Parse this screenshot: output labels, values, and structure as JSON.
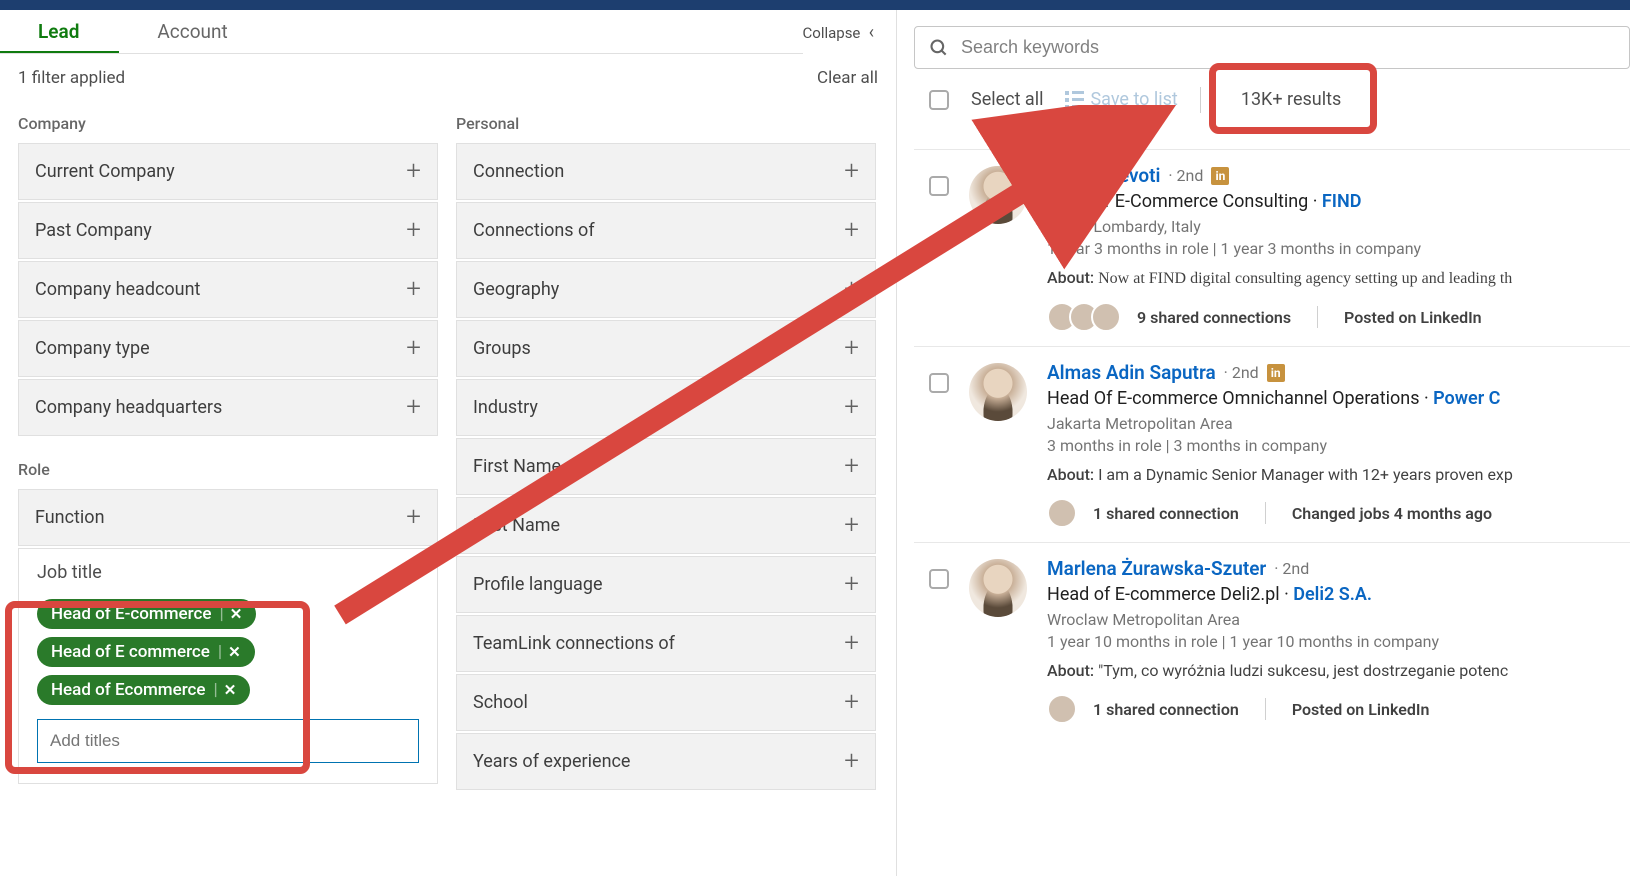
{
  "tabs": {
    "lead": "Lead",
    "account": "Account"
  },
  "header": {
    "filters_applied": "1 filter applied",
    "collapse": "Collapse",
    "clear_all": "Clear all"
  },
  "sections": {
    "company": "Company",
    "role": "Role",
    "personal": "Personal"
  },
  "filters": {
    "current_company": "Current Company",
    "past_company": "Past Company",
    "company_headcount": "Company headcount",
    "company_type": "Company type",
    "company_headquarters": "Company headquarters",
    "function_f": "Function",
    "job_title": "Job title",
    "connection": "Connection",
    "connections_of": "Connections of",
    "geography": "Geography",
    "groups": "Groups",
    "industry": "Industry",
    "first_name": "First Name",
    "last_name": "Last Name",
    "profile_language": "Profile language",
    "teamlink": "TeamLink connections of",
    "school": "School",
    "years_exp": "Years of experience"
  },
  "job_title_chips": [
    "Head of E-commerce",
    "Head of E commerce",
    "Head of Ecommerce"
  ],
  "job_title_placeholder": "Add titles",
  "search": {
    "placeholder": "Search keywords"
  },
  "results_bar": {
    "select_all": "Select all",
    "save_to_list": "Save to list",
    "count": "13K+ results"
  },
  "results": [
    {
      "name": "Mattia Devoti",
      "degree": "2nd",
      "badge": "in",
      "title": "Head of E-Commerce Consulting",
      "company": "FIND",
      "location": "Milan, Lombardy, Italy",
      "tenure": "1 year 3 months in role | 1 year 3 months in company",
      "about_label": "About:",
      "about": "Now at FIND digital consulting agency setting up and leading th",
      "about_style": "serif",
      "shared_count": 3,
      "shared_text": "9 shared connections",
      "meta2": "Posted on LinkedIn"
    },
    {
      "name": "Almas Adin Saputra",
      "degree": "2nd",
      "badge": "in",
      "title": "Head Of E-commerce Omnichannel Operations",
      "company": "Power C",
      "location": "Jakarta Metropolitan Area",
      "tenure": "3 months in role | 3 months in company",
      "about_label": "About:",
      "about": "I am a Dynamic Senior Manager with 12+ years proven exp",
      "about_style": "",
      "shared_count": 1,
      "shared_text": "1 shared connection",
      "meta2": "Changed jobs 4 months ago"
    },
    {
      "name": "Marlena Żurawska-Szuter",
      "degree": "2nd",
      "badge": "",
      "title": "Head of E-commerce Deli2.pl",
      "company": "Deli2 S.A.",
      "location": "Wroclaw Metropolitan Area",
      "tenure": "1 year 10 months in role | 1 year 10 months in company",
      "about_label": "About:",
      "about": "\"Tym, co wyróżnia ludzi sukcesu, jest dostrzeganie potenc",
      "about_style": "",
      "shared_count": 1,
      "shared_text": "1 shared connection",
      "meta2": "Posted on LinkedIn"
    }
  ]
}
